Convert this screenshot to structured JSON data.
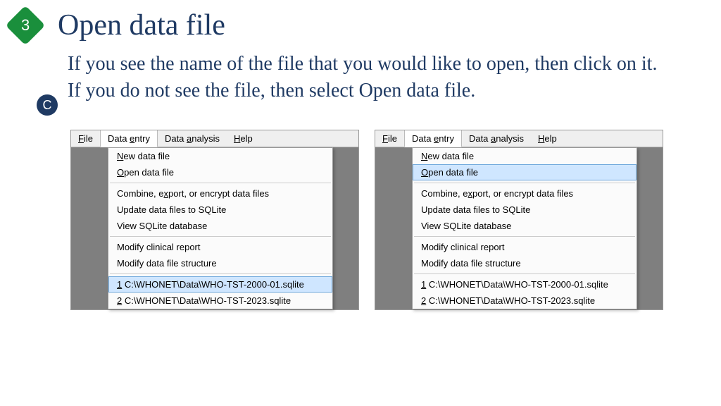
{
  "step_number": "3",
  "title": "Open data file",
  "sub_badge": "C",
  "description_line1": "If you see the name of the file that you would like to open, then click on it.",
  "description_line2": "If you do not see the file, then select Open data file.",
  "menubar": {
    "file": "File",
    "file_u": "F",
    "data_entry": "Data entry",
    "data_entry_u": "e",
    "data_analysis": "Data analysis",
    "data_analysis_u": "a",
    "help": "Help",
    "help_u": "H"
  },
  "dropdown": {
    "new_file": "New data file",
    "open_file": "Open data file",
    "combine": "Combine, export, or encrypt data files",
    "update": "Update data files to SQLite",
    "view": "View SQLite database",
    "modify_clinical": "Modify clinical report",
    "modify_structure": "Modify data file structure",
    "recent1_num": "1",
    "recent1_path": " C:\\WHONET\\Data\\WHO-TST-2000-01.sqlite",
    "recent2_num": "2",
    "recent2_path": " C:\\WHONET\\Data\\WHO-TST-2023.sqlite"
  }
}
